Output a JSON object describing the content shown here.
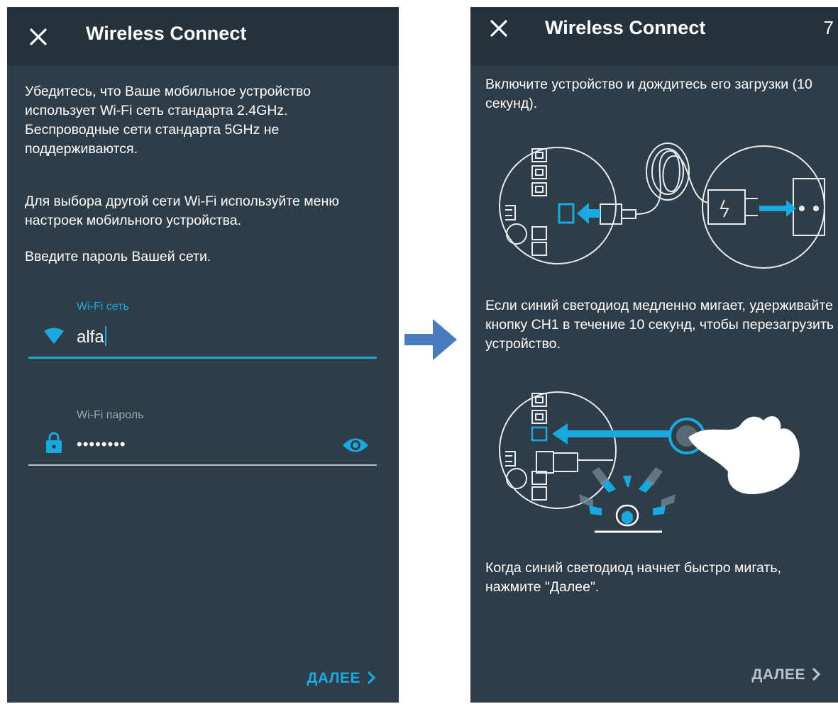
{
  "colors": {
    "screen_bg": "#2e3d48",
    "topbar_bg": "#26323b",
    "accent": "#1aa8e0",
    "muted": "#9aa7b0",
    "arrow": "#4a7bbf"
  },
  "left": {
    "title": "Wireless Connect",
    "paragraph1": "Убедитесь, что Ваше мобильное устройство использует Wi-Fi сеть стандарта 2.4GHz. Беспроводные сети стандарта 5GHz не поддерживаются.",
    "paragraph2": "Для выбора другой сети Wi-Fi используйте меню настроек мобильного устройства.",
    "paragraph3": "Введите пароль Вашей сети.",
    "wifi_field": {
      "label": "Wi-Fi сеть",
      "value": "alfa",
      "icon": "wifi-icon"
    },
    "password_field": {
      "label": "Wi-Fi пароль",
      "value": "••••••••",
      "icon": "lock-icon",
      "toggle_icon": "eye-icon"
    },
    "next_label": "ДАЛЕЕ"
  },
  "right": {
    "title": "Wireless Connect",
    "step": "7",
    "paragraph1": "Включите устройство и  дождитесь его загрузки (10 секунд).",
    "paragraph2": "Если синий светодиод медленно мигает, удерживайте кнопку CH1 в течение 10 секунд, чтобы перезагрузить устройство.",
    "paragraph3": "Когда синий светодиод начнет быстро мигать, нажмите \"Далее\".",
    "next_label": "ДАЛЕЕ"
  }
}
